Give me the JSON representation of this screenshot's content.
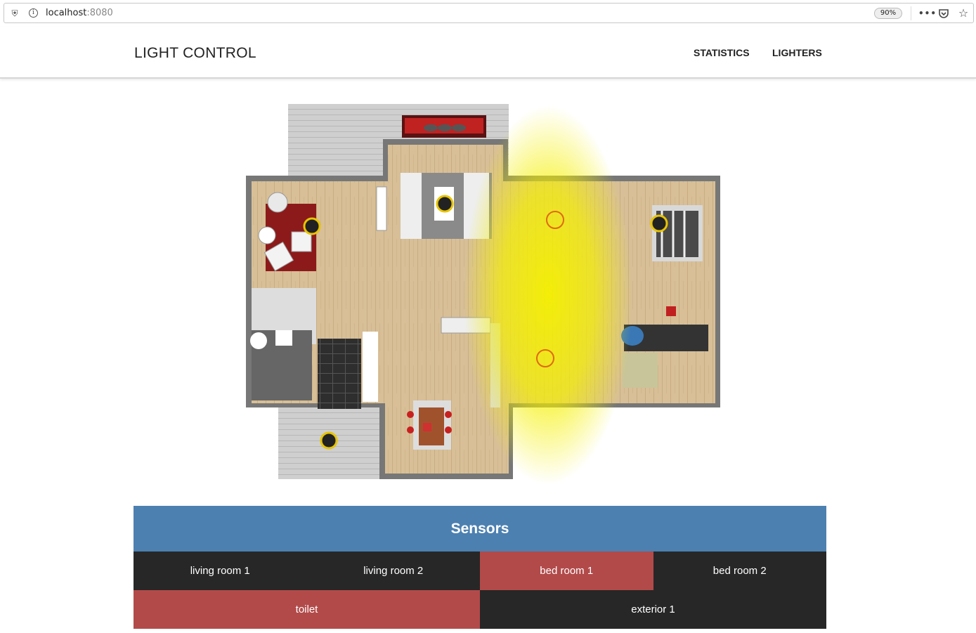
{
  "browser": {
    "url_host": "localhost",
    "url_port": ":8080",
    "zoom": "90%"
  },
  "nav": {
    "brand": "LIGHT CONTROL",
    "links": [
      "STATISTICS",
      "LIGHTERS"
    ]
  },
  "sensors": {
    "title": "Sensors",
    "rows": [
      [
        {
          "label": "living room 1",
          "state": "off"
        },
        {
          "label": "living room 2",
          "state": "off"
        },
        {
          "label": "bed room 1",
          "state": "on"
        },
        {
          "label": "bed room 2",
          "state": "off"
        }
      ],
      [
        {
          "label": "toilet",
          "state": "on"
        },
        {
          "label": "exterior 1",
          "state": "off"
        }
      ]
    ]
  },
  "colors": {
    "accent_blue": "#4c80b0",
    "sensor_on": "#b24a4a",
    "sensor_off": "#272727",
    "light_glow": "#f5f000"
  },
  "icons": [
    "shield-icon",
    "info-icon",
    "more-icon",
    "pocket-icon",
    "star-icon"
  ]
}
